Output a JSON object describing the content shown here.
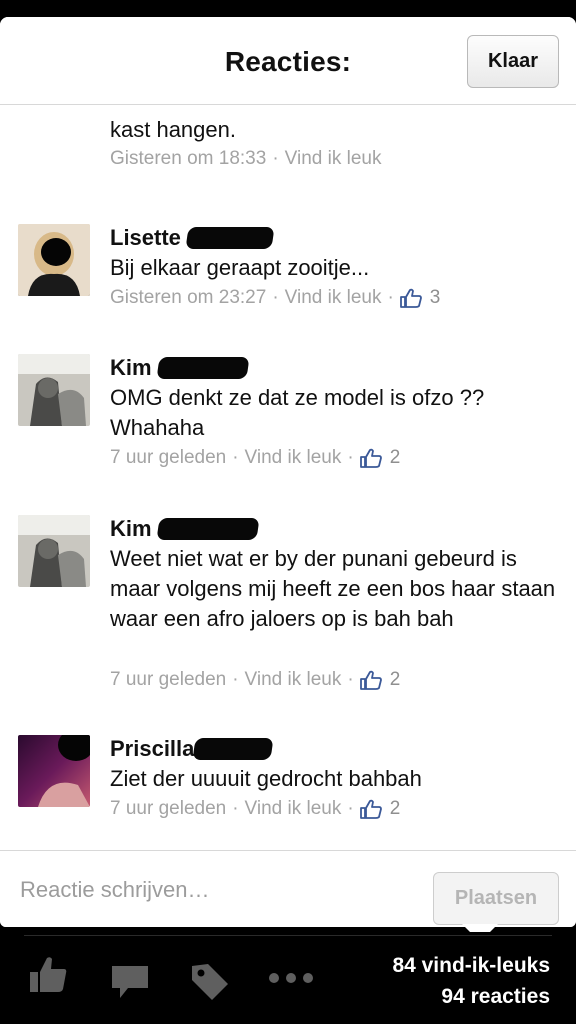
{
  "header": {
    "title": "Reacties:",
    "done_label": "Klaar"
  },
  "comments": [
    {
      "author": "",
      "text": "kast hangen.",
      "time": "Gisteren om 18:33",
      "like_label": "Vind ik leuk",
      "likes": ""
    },
    {
      "author": "Lisette",
      "text": "Bij elkaar geraapt zooitje...",
      "time": "Gisteren om 23:27",
      "like_label": "Vind ik leuk",
      "likes": "3"
    },
    {
      "author": "Kim",
      "text": "OMG denkt ze dat ze model is ofzo ?? Whahaha",
      "time": "7 uur geleden",
      "like_label": "Vind ik leuk",
      "likes": "2"
    },
    {
      "author": "Kim",
      "text": "Weet niet wat er by der punani gebeurd is maar volgens mij heeft ze een bos haar staan waar een afro jaloers op is bah bah",
      "time": "7 uur geleden",
      "like_label": "Vind ik leuk",
      "likes": "2"
    },
    {
      "author": "Priscilla",
      "text": "Ziet der uuuuit gedrocht bahbah",
      "time": "7 uur geleden",
      "like_label": "Vind ik leuk",
      "likes": "2"
    }
  ],
  "composer": {
    "placeholder": "Reactie schrijven…",
    "post_label": "Plaatsen"
  },
  "footer": {
    "likes_count": "84 vind-ik-leuks",
    "comments_count": "94 reacties"
  },
  "icons": {
    "like": "thumbs-up-icon",
    "comment": "speech-bubble-icon",
    "tag": "tag-icon",
    "more": "more-icon"
  },
  "colors": {
    "link_blue": "#3b5998",
    "meta_gray": "#a3a3a3",
    "toolbar_icon": "#5f5f5f"
  }
}
